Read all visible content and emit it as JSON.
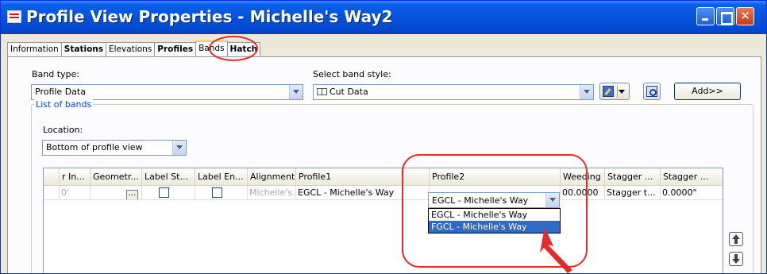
{
  "window": {
    "title": "Profile View Properties - Michelle's Way2"
  },
  "tabs": [
    {
      "label": "Information"
    },
    {
      "label": "Stations"
    },
    {
      "label": "Elevations"
    },
    {
      "label": "Profiles"
    },
    {
      "label": "Bands"
    },
    {
      "label": "Hatch"
    }
  ],
  "band_type": {
    "label": "Band type:",
    "value": "Profile Data"
  },
  "band_style": {
    "label": "Select band style:",
    "value": "Cut Data"
  },
  "add_button": "Add>>",
  "list_of_bands": {
    "legend": "List of bands",
    "location_label": "Location:",
    "location_value": "Bottom of profile view",
    "columns": [
      "r In...",
      "Geometr...",
      "Label St...",
      "Label En...",
      "Alignment",
      "Profile1",
      "Profile2",
      "Weeding",
      "Stagger ...",
      "Stagger ..."
    ],
    "row": {
      "r_in": "0'",
      "alignment": "Michelle's...",
      "profile1": "EGCL - Michelle's Way",
      "profile2": "EGCL - Michelle's Way",
      "weeding": "00.0000",
      "stagger1": "Stagger t...",
      "stagger2": "0.0000\""
    },
    "profile2_options": [
      "EGCL - Michelle's Way",
      "FGCL - Michelle's Way"
    ]
  },
  "annotation": {
    "color": "#e22b2b"
  }
}
